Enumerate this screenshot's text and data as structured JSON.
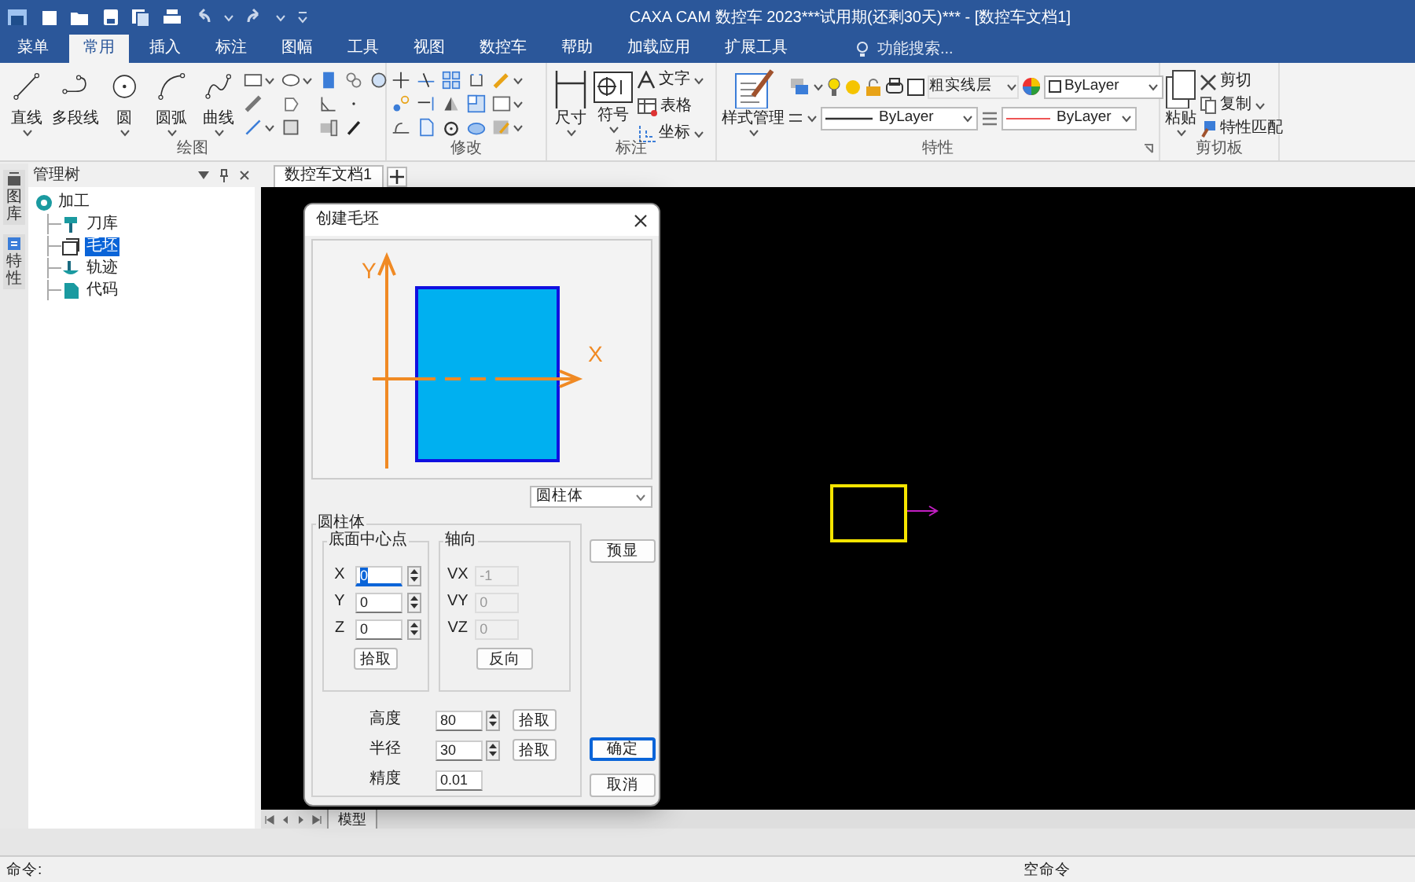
{
  "title_bar": {
    "title": "CAXA CAM 数控车 2023***试用期(还剩30天)*** - [数控车文档1]"
  },
  "ribbon_tabs": [
    {
      "label": "菜单",
      "selected": false
    },
    {
      "label": "常用",
      "selected": true
    },
    {
      "label": "插入",
      "selected": false
    },
    {
      "label": "标注",
      "selected": false
    },
    {
      "label": "图幅",
      "selected": false
    },
    {
      "label": "工具",
      "selected": false
    },
    {
      "label": "视图",
      "selected": false
    },
    {
      "label": "数控车",
      "selected": false
    },
    {
      "label": "帮助",
      "selected": false
    },
    {
      "label": "加载应用",
      "selected": false
    },
    {
      "label": "扩展工具",
      "selected": false
    }
  ],
  "search": {
    "placeholder": "功能搜索..."
  },
  "draw_group": {
    "label": "绘图",
    "tools": [
      {
        "label": "直线",
        "dropdown": true
      },
      {
        "label": "多段线",
        "dropdown": false
      },
      {
        "label": "圆",
        "dropdown": true
      },
      {
        "label": "圆弧",
        "dropdown": true
      },
      {
        "label": "曲线",
        "dropdown": true
      }
    ]
  },
  "modify_group": {
    "label": "修改"
  },
  "annotate_group": {
    "label": "标注",
    "large_tools": [
      "尺寸",
      "符号"
    ],
    "small_tools": [
      "文字",
      "表格",
      "坐标"
    ]
  },
  "properties_group": {
    "label": "特性",
    "style_manager": "样式管理",
    "layer": "粗实线层",
    "color_combo": "ByLayer",
    "linetype": "ByLayer",
    "lineweight": "ByLayer"
  },
  "clipboard_group": {
    "label": "剪切板",
    "paste": "粘贴",
    "cut": "剪切",
    "copy": "复制",
    "match": "特性匹配"
  },
  "side_tabs": [
    {
      "label": "图库"
    },
    {
      "label": "特性"
    }
  ],
  "tree_panel": {
    "title": "管理树",
    "root": "加工",
    "items": [
      {
        "label": "刀库",
        "selected": false
      },
      {
        "label": "毛坯",
        "selected": true
      },
      {
        "label": "轨迹",
        "selected": false
      },
      {
        "label": "代码",
        "selected": false
      }
    ]
  },
  "doc_tabs": [
    {
      "label": "数控车文档1",
      "selected": true
    }
  ],
  "dialog": {
    "title": "创建毛坯",
    "preview": {
      "axis_x": "X",
      "axis_y": "Y"
    },
    "shape": "圆柱体",
    "group_title": "圆柱体",
    "center": {
      "title": "底面中心点",
      "pick": "拾取",
      "fields": [
        {
          "label": "X",
          "value": "0",
          "focused": true
        },
        {
          "label": "Y",
          "value": "0",
          "focused": false
        },
        {
          "label": "Z",
          "value": "0",
          "focused": false
        }
      ]
    },
    "axis": {
      "title": "轴向",
      "reverse": "反向",
      "fields": [
        {
          "label": "VX",
          "value": "-1",
          "disabled": true
        },
        {
          "label": "VY",
          "value": "0",
          "disabled": true
        },
        {
          "label": "VZ",
          "value": "0",
          "disabled": true
        }
      ]
    },
    "preview_button": "预显",
    "params": [
      {
        "label": "高度",
        "value": "80",
        "kind": "spinpick",
        "pick": "拾取"
      },
      {
        "label": "半径",
        "value": "30",
        "kind": "spinpick",
        "pick": "拾取"
      },
      {
        "label": "精度",
        "value": "0.01",
        "kind": "plain"
      }
    ],
    "ok": "确定",
    "cancel": "取消"
  },
  "model_tabs": [
    {
      "label": "模型",
      "selected": true
    }
  ],
  "status_bar": {
    "prompt": "命令:",
    "command": "空命令"
  }
}
